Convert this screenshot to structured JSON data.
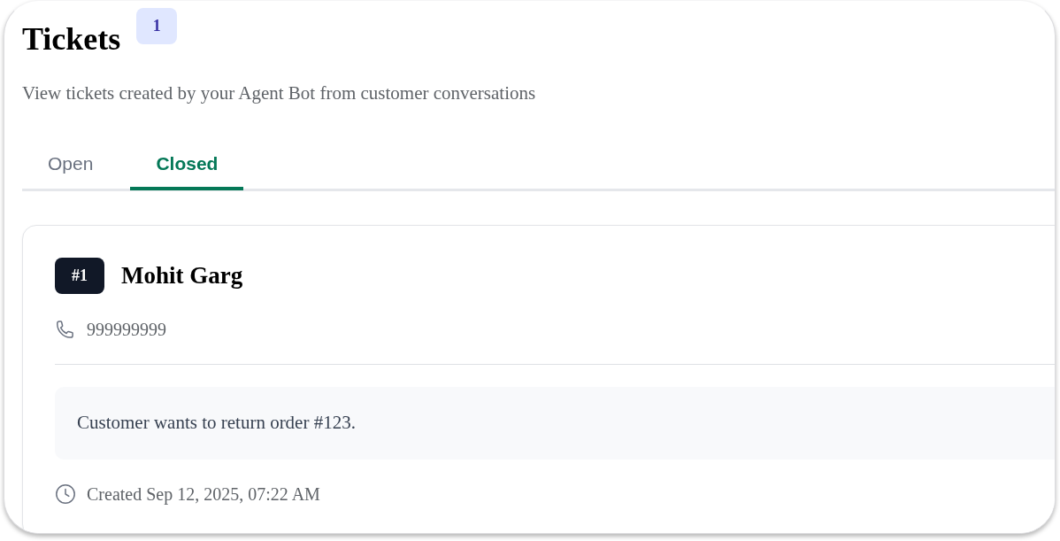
{
  "header": {
    "title": "Tickets",
    "count": "1",
    "subtitle": "View tickets created by your Agent Bot from customer conversations"
  },
  "tabs": [
    {
      "label": "Open",
      "selected": false
    },
    {
      "label": "Closed",
      "selected": true
    }
  ],
  "tickets": [
    {
      "number": "#1",
      "name": "Mohit Garg",
      "phone": "999999999",
      "summary": "Customer wants to return order #123.",
      "created": "Created Sep 12, 2025, 07:22 AM"
    }
  ]
}
